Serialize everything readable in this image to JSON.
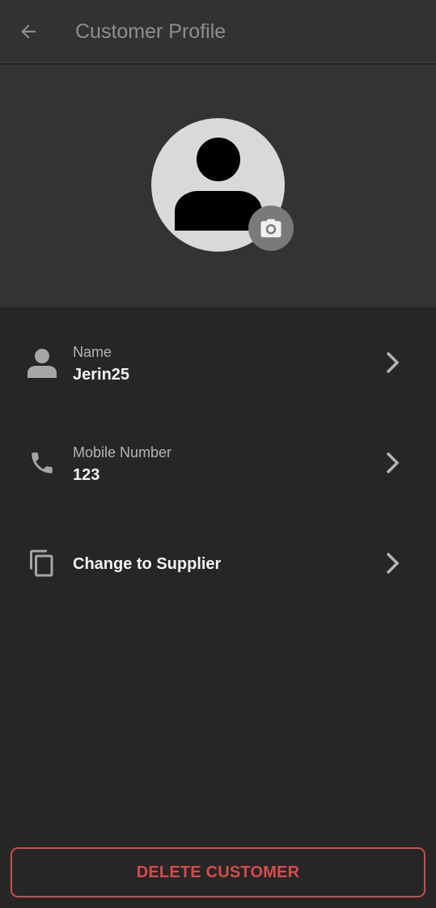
{
  "app_bar": {
    "title": "Customer Profile",
    "back_icon": "arrow-left-icon"
  },
  "avatar": {
    "icon": "person-icon",
    "camera_icon": "camera-icon"
  },
  "rows": [
    {
      "icon": "person-icon",
      "label": "Name",
      "value": "Jerin25"
    },
    {
      "icon": "phone-icon",
      "label": "Mobile Number",
      "value": "123"
    },
    {
      "icon": "copy-icon",
      "label": "",
      "value": "Change to Supplier"
    }
  ],
  "delete_button": {
    "label": "DELETE CUSTOMER"
  },
  "colors": {
    "background": "#262626",
    "app_bar": "#323232",
    "header_section": "#333333",
    "danger": "#d94a4a",
    "icon_grey": "#a6a6a6"
  }
}
